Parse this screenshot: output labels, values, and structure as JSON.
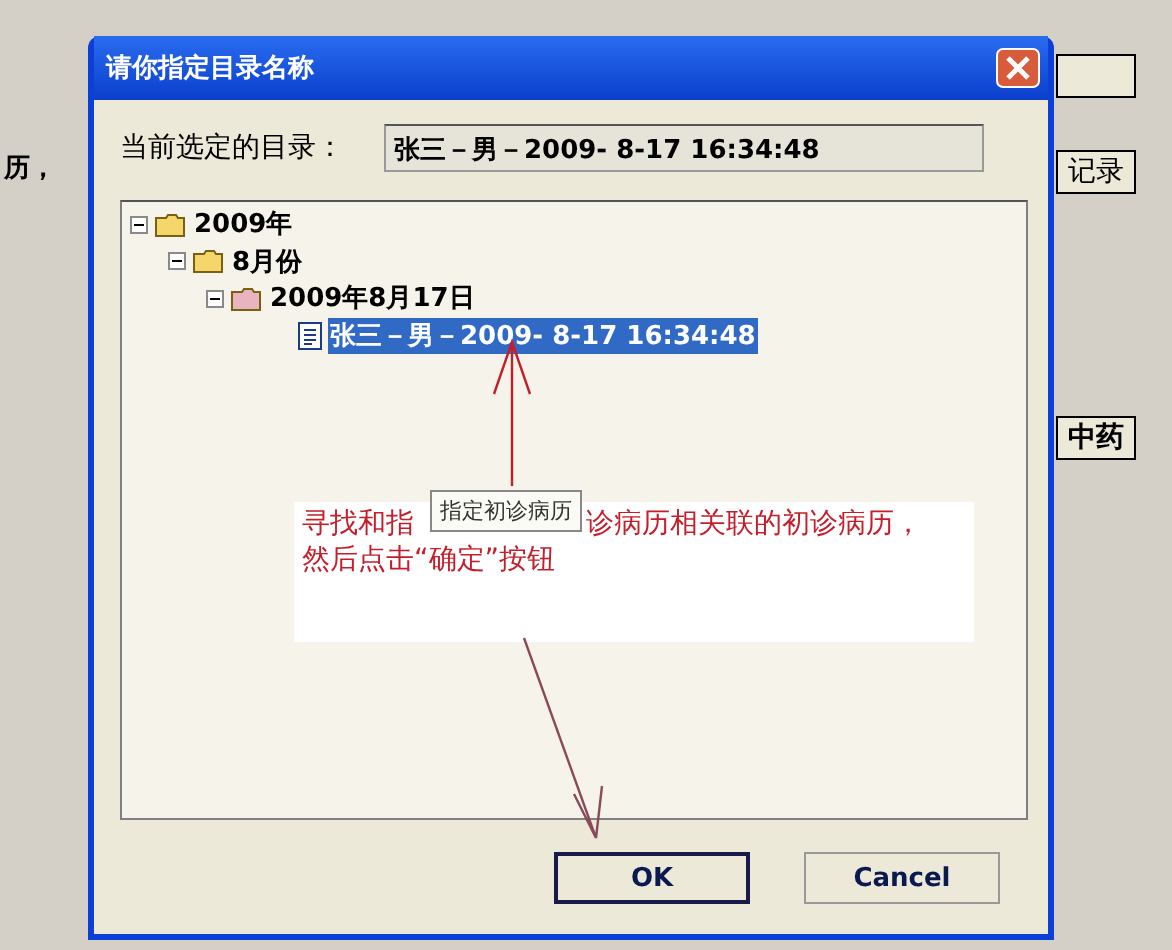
{
  "background": {
    "label": "历，",
    "buttons": [
      {
        "kind": "partial"
      },
      {
        "kind": "text",
        "label": "记录"
      },
      {
        "kind": "text",
        "label": "中药"
      }
    ]
  },
  "dialog": {
    "title": "请你指定目录名称",
    "current_label": "当前选定的目录：",
    "current_value": "张三－男－2009- 8-17 16:34:48",
    "tree": [
      {
        "label": "2009年",
        "kind": "folder",
        "expanded": true,
        "selected": false,
        "children": [
          {
            "label": "8月份",
            "kind": "folder",
            "expanded": true,
            "selected": false,
            "children": [
              {
                "label": "2009年8月17日",
                "kind": "folder",
                "expanded": true,
                "selected": false,
                "children": [
                  {
                    "label": "张三－男－2009- 8-17 16:34:48",
                    "kind": "document",
                    "selected": true
                  }
                ]
              }
            ]
          }
        ]
      }
    ],
    "annotation": {
      "tooltip": "指定初诊病历",
      "note_parts": [
        "寻找和指",
        "诊病历相关联的初诊病历，"
      ],
      "note_line_2": "然后点击“确定”按钮"
    },
    "buttons": [
      {
        "label": "OK",
        "default": true
      },
      {
        "label": "Cancel",
        "default": false
      }
    ]
  }
}
